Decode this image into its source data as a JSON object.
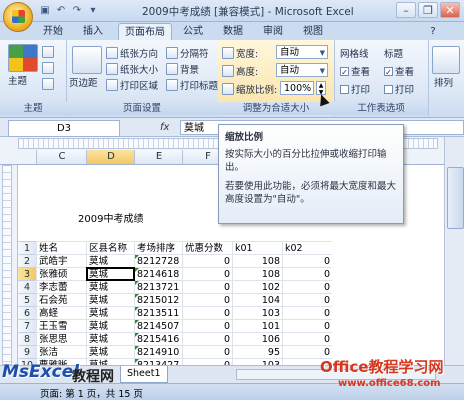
{
  "window": {
    "title": "2009中考成绩 [兼容模式] - Microsoft Excel",
    "minimize": "–",
    "restore": "❐",
    "close": "✕"
  },
  "tabs": [
    "开始",
    "插入",
    "页面布局",
    "公式",
    "数据",
    "审阅",
    "视图"
  ],
  "active_tab": "页面布局",
  "ribbon": {
    "themes": {
      "button": "主题",
      "label": "主题"
    },
    "page_setup": {
      "margins": "页边距",
      "orientation": "纸张方向",
      "size": "纸张大小",
      "print_area": "打印区域",
      "breaks": "分隔符",
      "background": "背景",
      "print_titles": "打印标题",
      "label": "页面设置"
    },
    "scale_to_fit": {
      "width_label": "宽度:",
      "width_value": "自动",
      "height_label": "高度:",
      "height_value": "自动",
      "scale_label": "缩放比例:",
      "scale_value": "100%",
      "label": "调整为合适大小"
    },
    "sheet_options": {
      "gridlines": "网格线",
      "headings": "标题",
      "view": "查看",
      "print": "打印",
      "label": "工作表选项"
    },
    "arrange": {
      "label": "排列"
    }
  },
  "formula_bar": {
    "name_box": "D3",
    "fx": "fx",
    "value": "莫城"
  },
  "columns": [
    "C",
    "D",
    "E",
    "F"
  ],
  "tooltip": {
    "title": "缩放比例",
    "p1": "按实际大小的百分比拉伸或收缩打印输出。",
    "p2": "若要使用此功能，必须将最大宽度和最大高度设置为\"自动\"。"
  },
  "sheet": {
    "heading": "2009中考成绩",
    "headers": [
      "姓名",
      "区县名称",
      "考场排序",
      "优惠分数",
      "k01",
      "k02"
    ],
    "rows": [
      {
        "n": "2",
        "name": "武皓宇",
        "district": "莫城",
        "rank": "8212728",
        "bonus": "0",
        "k01": "108",
        "k02": "0"
      },
      {
        "n": "3",
        "name": "张雅硕",
        "district": "莫城",
        "rank": "8214618",
        "bonus": "0",
        "k01": "108",
        "k02": "0"
      },
      {
        "n": "4",
        "name": "李志蕾",
        "district": "莫城",
        "rank": "8213721",
        "bonus": "0",
        "k01": "102",
        "k02": "0"
      },
      {
        "n": "5",
        "name": "石会苑",
        "district": "莫城",
        "rank": "8215012",
        "bonus": "0",
        "k01": "104",
        "k02": "0"
      },
      {
        "n": "6",
        "name": "高蛏",
        "district": "莫城",
        "rank": "8213511",
        "bonus": "0",
        "k01": "103",
        "k02": "0"
      },
      {
        "n": "7",
        "name": "王玉雪",
        "district": "莫城",
        "rank": "8214507",
        "bonus": "0",
        "k01": "101",
        "k02": "0"
      },
      {
        "n": "8",
        "name": "张思思",
        "district": "莫城",
        "rank": "8215416",
        "bonus": "0",
        "k01": "106",
        "k02": "0"
      },
      {
        "n": "9",
        "name": "张洁",
        "district": "莫城",
        "rank": "8214910",
        "bonus": "0",
        "k01": "95",
        "k02": "0"
      },
      {
        "n": "10",
        "name": "曹雅晰",
        "district": "莫城",
        "rank": "8213427",
        "bonus": "0",
        "k01": "103",
        "k02": "0"
      }
    ],
    "header_row_n": "1",
    "tab": "Sheet1"
  },
  "status": {
    "text": "页面: 第 1 页，共 15 页"
  },
  "watermarks": {
    "left": "MsExcel",
    "mid": "教程网",
    "right": "Office教程学习网",
    "url": "www.office68.com"
  }
}
